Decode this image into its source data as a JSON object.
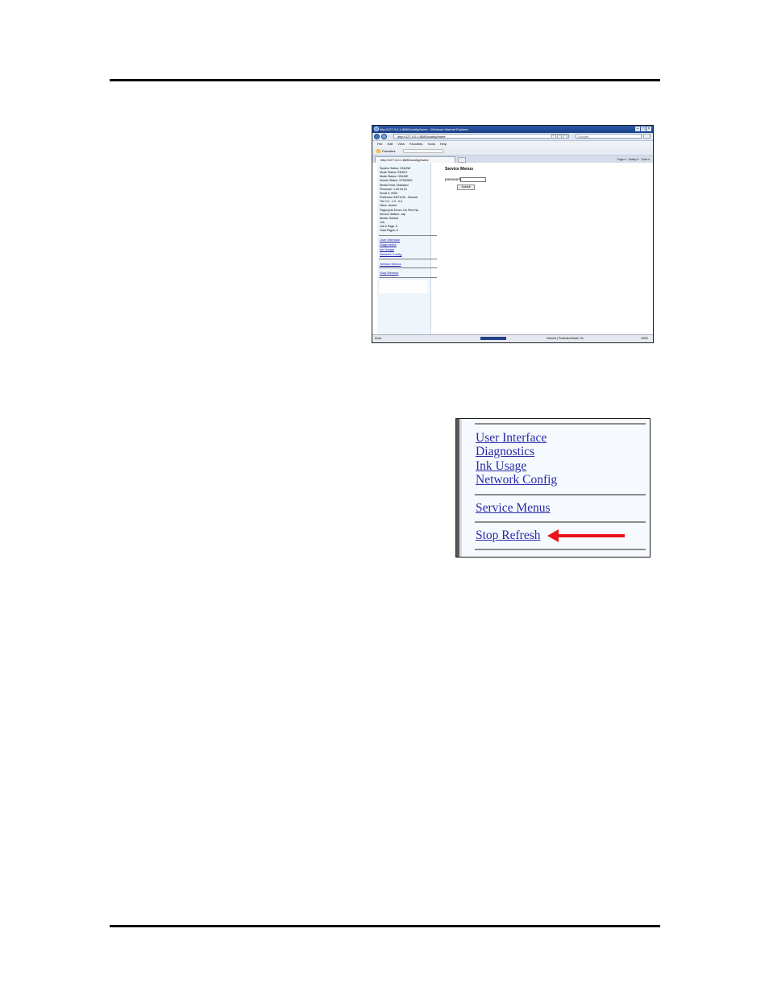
{
  "browser": {
    "title": "http://127.0.0.1:8080/config/home - Windows Internet Explorer",
    "url": "http://127.0.0.1:8080/config/home",
    "search_placeholder": "Google",
    "menus": [
      "File",
      "Edit",
      "View",
      "Favorites",
      "Tools",
      "Help"
    ],
    "favorites_label": "Favorites",
    "tab_label": "http://127.0.0.1:8080/config/home",
    "command_items": [
      "Page ▾",
      "Safety ▾",
      "Tools ▾"
    ],
    "sidebar_status_lines": [
      "System Status: ONLINE",
      "Mode Status: READY",
      "Mode Status: ONLINE",
      "Nozzle Status: STANDBY",
      "Media Feed: Standard",
      "Firmware: 1.00.04.01",
      "Serial #: 0000",
      "Printhead: ABT1130 - Normal",
      "Tilt: 0.0 - 1.0 - 0.0",
      "Valve: closed",
      "Pagecycle Errors: No Print No",
      "Service Station: cap",
      "Media: Default",
      "Job:",
      "Job # Page: 5",
      "Total Pages: 9"
    ],
    "sidebar_links": [
      "User Interface",
      "Diagnostics",
      "Ink Usage",
      "Network Config"
    ],
    "service_link": "Service Menus",
    "stop_link": "Stop Refresh",
    "main_title": "Service Menus",
    "password_label": "password",
    "submit_label": "Submit",
    "status_done": "Done",
    "status_zone": "Internet | Protected Mode: On",
    "status_zoom": "100%"
  },
  "zoom_panel": {
    "links": [
      "User Interface",
      "Diagnostics",
      "Ink Usage",
      "Network Config"
    ],
    "service_link": "Service Menus",
    "stop_link": "Stop Refresh",
    "arrow_color": "#e8141c"
  }
}
